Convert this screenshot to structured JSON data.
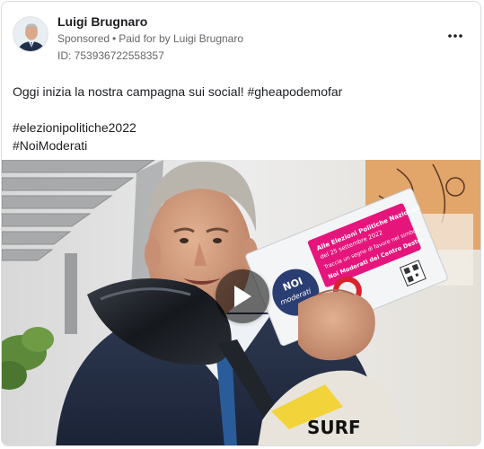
{
  "post": {
    "author": "Luigi Brugnaro",
    "sponsored_label": "Sponsored",
    "separator": "•",
    "paid_for_label": "Paid for by",
    "payer": "Luigi Brugnaro",
    "ad_id": "ID: 753936722558357",
    "more_icon": "more-horizontal-icon",
    "text_lines": [
      "Oggi inizia la nostra campagna sui social! #gheapodemofar",
      "#elezionipolitiche2022",
      "#NoiModerati"
    ]
  },
  "video": {
    "play_icon": "play-icon",
    "flyer": {
      "logo_top": "NOI",
      "logo_bottom": "moderati",
      "headline": "Alle Elezioni Politiche Nazionali",
      "date": "del 25 settembre 2022",
      "instruction": "Traccia un segno di favore nel simbolo",
      "party": "Noi Moderati del Centro Destra"
    },
    "pouch_text": "SURF"
  },
  "colors": {
    "text": "#1c1e21",
    "secondary": "#65676b",
    "border": "#dadde1",
    "flyer_magenta": "#e6157c"
  }
}
